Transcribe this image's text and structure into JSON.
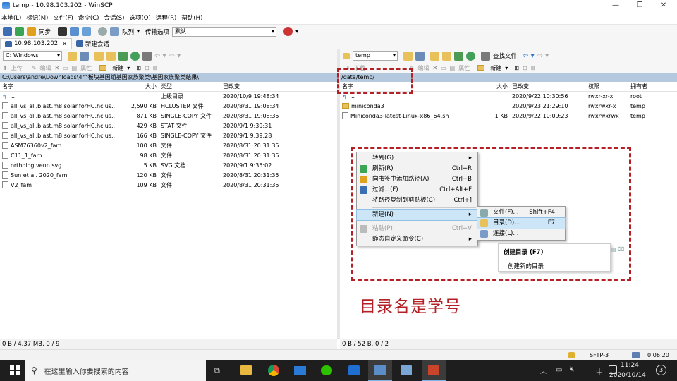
{
  "window": {
    "title": "temp - 10.98.103.202 - WinSCP"
  },
  "menubar": [
    "本地(L)",
    "标记(M)",
    "文件(F)",
    "命令(C)",
    "会话(S)",
    "选项(O)",
    "远程(R)",
    "帮助(H)"
  ],
  "toolbar": {
    "sync": "同步",
    "queue": "队列",
    "transfer_label": "传输选项",
    "transfer_value": "默认"
  },
  "session": {
    "tab": "10.98.103.202",
    "new_session": "新建会话"
  },
  "left": {
    "drive": "C: Windows",
    "actions": {
      "upload": "上传",
      "edit": "编辑",
      "props": "属性",
      "new": "新建"
    },
    "path": "C:\\Users\\andre\\Downloads\\4个板块基因组基因家族聚类\\基因家族聚类结果\\",
    "headers": {
      "name": "名字",
      "size": "大小",
      "type": "类型",
      "modified": "已改变"
    },
    "files": [
      {
        "name": "..",
        "size": "",
        "type": "上级目录",
        "date": "2020/10/9  19:48:34"
      },
      {
        "name": "all_vs_all.blast.m8.solar.forHC.hclus...",
        "size": "2,590 KB",
        "type": "HCLUSTER 文件",
        "date": "2020/8/31  19:08:34"
      },
      {
        "name": "all_vs_all.blast.m8.solar.forHC.hclus...",
        "size": "871 KB",
        "type": "SINGLE-COPY 文件",
        "date": "2020/8/31  19:08:35"
      },
      {
        "name": "all_vs_all.blast.m8.solar.forHC.hclus...",
        "size": "429 KB",
        "type": "STAT 文件",
        "date": "2020/9/1  9:39:31"
      },
      {
        "name": "all_vs_all.blast.m8.solar.forHC.hclus...",
        "size": "166 KB",
        "type": "SINGLE-COPY 文件",
        "date": "2020/9/1  9:39:28"
      },
      {
        "name": "ASM76360v2_fam",
        "size": "100 KB",
        "type": "文件",
        "date": "2020/8/31  20:31:35"
      },
      {
        "name": "C11_1_fam",
        "size": "98 KB",
        "type": "文件",
        "date": "2020/8/31  20:31:35"
      },
      {
        "name": "ortholog.venn.svg",
        "size": "5 KB",
        "type": "SVG 文档",
        "date": "2020/9/1  9:35:02"
      },
      {
        "name": "Sun et al. 2020_fam",
        "size": "120 KB",
        "type": "文件",
        "date": "2020/8/31  20:31:35"
      },
      {
        "name": "V2_fam",
        "size": "109 KB",
        "type": "文件",
        "date": "2020/8/31  20:31:35"
      }
    ],
    "status": "0 B / 4.37 MB,  0 / 9"
  },
  "right": {
    "drive": "temp",
    "find": "查找文件",
    "actions": {
      "download": "下载",
      "edit": "编辑",
      "props": "属性",
      "new": "新建"
    },
    "path": "/data/temp/",
    "headers": {
      "name": "名字",
      "size": "大小",
      "modified": "已改变",
      "rights": "权限",
      "owner": "拥有者"
    },
    "files": [
      {
        "name": "..",
        "size": "",
        "date": "2020/9/22 10:30:56",
        "rights": "rwxr-xr-x",
        "owner": "root",
        "kind": "up"
      },
      {
        "name": "miniconda3",
        "size": "",
        "date": "2020/9/23 21:29:10",
        "rights": "rwxrwxr-x",
        "owner": "temp",
        "kind": "dir"
      },
      {
        "name": "Miniconda3-latest-Linux-x86_64.sh",
        "size": "1 KB",
        "date": "2020/9/22 10:09:23",
        "rights": "rwxrwxrwx",
        "owner": "temp",
        "kind": "file"
      }
    ],
    "status": "0 B / 52 B,  0 / 2"
  },
  "context_menu": [
    {
      "label": "转到(G)",
      "shortcut": "",
      "arrow": true
    },
    {
      "label": "刷新(R)",
      "shortcut": "Ctrl+R",
      "icon": "refresh-icon"
    },
    {
      "label": "向书签中添加路径(A)",
      "shortcut": "Ctrl+B",
      "icon": "bookmark-icon"
    },
    {
      "label": "过滤...(F)",
      "shortcut": "Ctrl+Alt+F",
      "icon": "filter-icon"
    },
    {
      "label": "将路径复制到剪贴板(C)",
      "shortcut": "Ctrl+]"
    },
    {
      "label": "新建(N)",
      "shortcut": "",
      "arrow": true,
      "highlight": true
    },
    {
      "label": "粘贴(P)",
      "shortcut": "Ctrl+V",
      "disabled": true,
      "icon": "paste-icon"
    },
    {
      "label": "静态自定义命令(C)",
      "shortcut": "",
      "arrow": true
    }
  ],
  "submenu": [
    {
      "label": "文件(F)...",
      "shortcut": "Shift+F4"
    },
    {
      "label": "目录(D)...",
      "shortcut": "F7",
      "highlight": true
    },
    {
      "label": "连接(L)...",
      "shortcut": ""
    }
  ],
  "tooltip": {
    "title": "创建目录 (F7)",
    "body": "创建新的目录"
  },
  "annotation": "目录名是学号",
  "status_bar": {
    "protocol": "SFTP-3",
    "time": "0:06:20"
  },
  "taskbar": {
    "search_placeholder": "在这里输入你要搜索的内容",
    "clock": "11:24",
    "date": "2020/10/14",
    "lang": "中",
    "notif": "3"
  },
  "colors": {
    "accent_red": "#b42025",
    "path_bar": "#b5c9de",
    "highlight": "#cde6f7"
  }
}
